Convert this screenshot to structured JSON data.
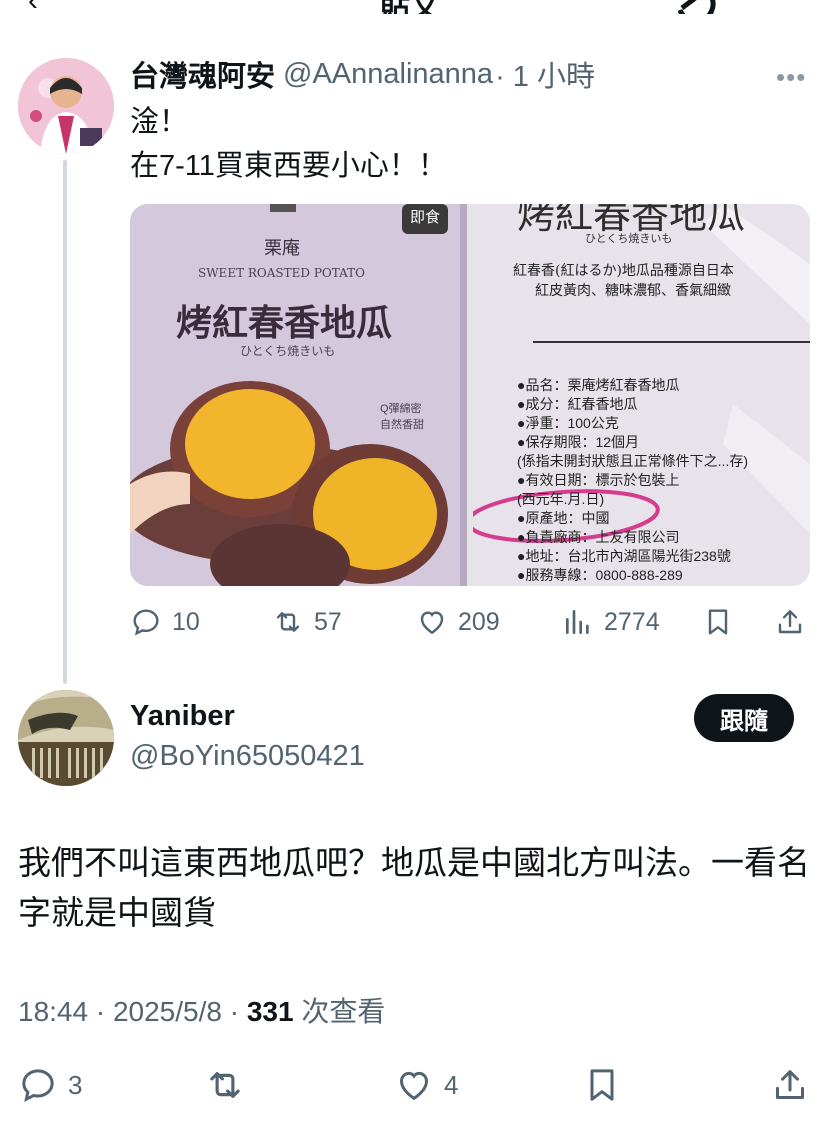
{
  "header": {
    "title": "貼文"
  },
  "parent": {
    "name": "台灣魂阿安",
    "handle": "@AAnnalinanna",
    "time": "· 1 小時",
    "text_line1": "淦！",
    "text_line2": "在7-11買東西要小心！！",
    "media": {
      "left": {
        "brand": "栗庵",
        "subtitle": "SWEET ROASTED POTATO",
        "name": "烤紅春香地瓜",
        "kana": "ひとくち焼きいも",
        "badge": "即食",
        "side": "Q彈綿密\n自然香甜"
      },
      "right": {
        "head": "烤紅春香地瓜",
        "kana": "ひとくち焼きいも",
        "desc1": "紅春香(紅はるか)地瓜品種源自日本",
        "desc2": "紅皮黃肉、糖味濃郁、香氣細緻",
        "lines": [
          "●品名：栗庵烤紅春香地瓜",
          "●成分：紅春香地瓜",
          "●淨重：100公克",
          "●保存期限：12個月",
          "(係指未開封狀態且正常條件下之...存)",
          "●有效日期：標示於包裝上",
          "(西元年.月.日)",
          "●原產地：中國",
          "●負責廠商：上友有限公司",
          "●地址：台北市內湖區陽光街238號",
          "●服務專線：0800-888-289"
        ]
      }
    },
    "stats": {
      "replies": "10",
      "reposts": "57",
      "likes": "209",
      "views": "2774"
    }
  },
  "reply": {
    "name": "Yaniber",
    "handle": "@BoYin65050421",
    "follow_label": "跟隨",
    "text": "我們不叫這東西地瓜吧？地瓜是中國北方叫法。一看名字就是中國貨",
    "timestamp": "18:44 · 2025/5/8 · ",
    "views_num": "331",
    "views_label": " 次查看",
    "stats": {
      "replies": "3",
      "likes": "4"
    }
  },
  "colors": {
    "text": "#0f1419",
    "secondary": "#536471",
    "line": "#cfd9de",
    "circle": "#d63c8e"
  }
}
